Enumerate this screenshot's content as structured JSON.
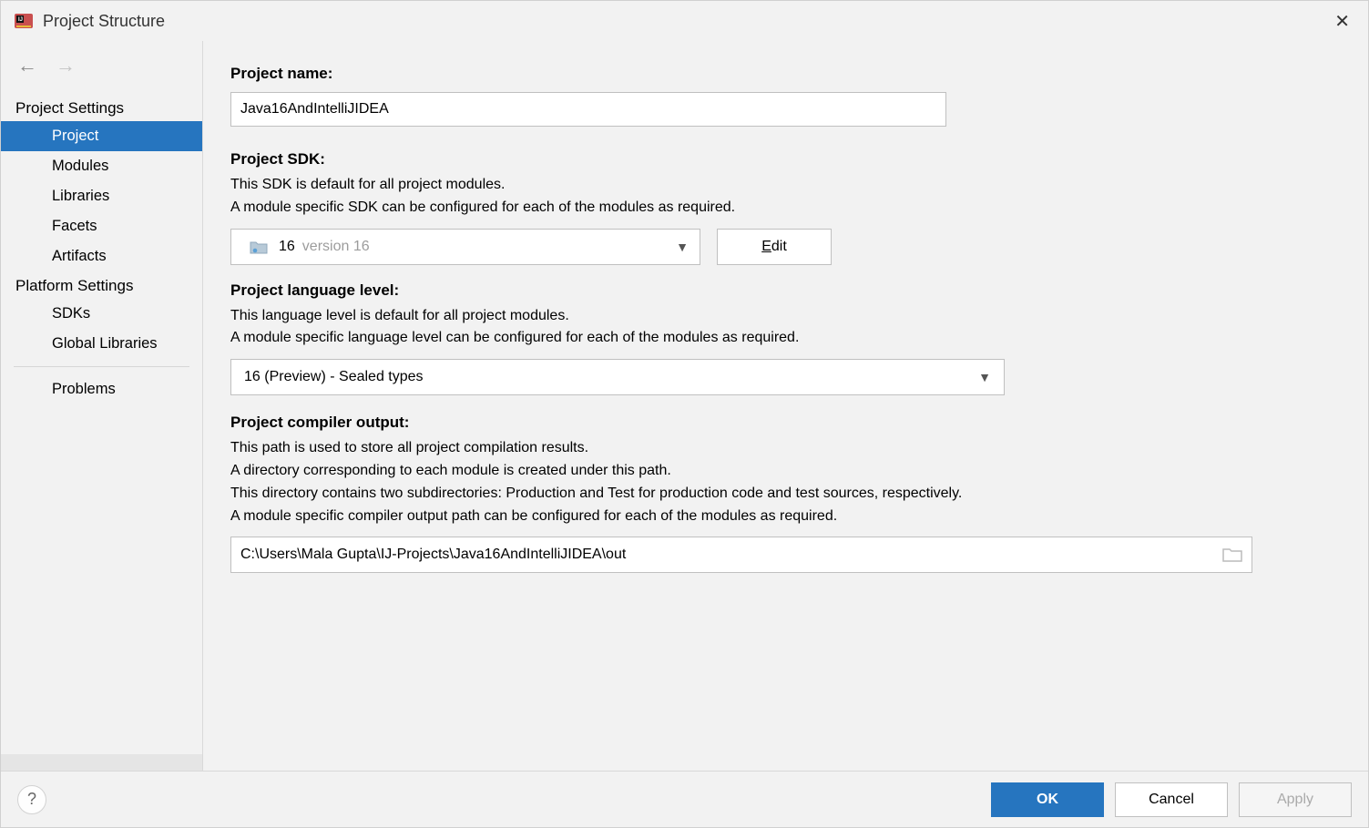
{
  "title": "Project Structure",
  "sidebar": {
    "heading_project_settings": "Project Settings",
    "items_project": [
      "Project",
      "Modules",
      "Libraries",
      "Facets",
      "Artifacts"
    ],
    "heading_platform_settings": "Platform Settings",
    "items_platform": [
      "SDKs",
      "Global Libraries"
    ],
    "item_problems": "Problems",
    "active": "Project"
  },
  "main": {
    "project_name_label": "Project name:",
    "project_name_value": "Java16AndIntelliJIDEA",
    "project_sdk_label": "Project SDK:",
    "project_sdk_desc1": "This SDK is default for all project modules.",
    "project_sdk_desc2": "A module specific SDK can be configured for each of the modules as required.",
    "sdk_selected_main": "16",
    "sdk_selected_version": "version 16",
    "edit_button": "Edit",
    "lang_level_label": "Project language level:",
    "lang_level_desc1": "This language level is default for all project modules.",
    "lang_level_desc2": "A module specific language level can be configured for each of the modules as required.",
    "lang_level_value": "16 (Preview) - Sealed types",
    "compiler_output_label": "Project compiler output:",
    "compiler_output_desc1": "This path is used to store all project compilation results.",
    "compiler_output_desc2": "A directory corresponding to each module is created under this path.",
    "compiler_output_desc3": "This directory contains two subdirectories: Production and Test for production code and test sources, respectively.",
    "compiler_output_desc4": "A module specific compiler output path can be configured for each of the modules as required.",
    "compiler_output_value": "C:\\Users\\Mala Gupta\\IJ-Projects\\Java16AndIntelliJIDEA\\out"
  },
  "footer": {
    "ok": "OK",
    "cancel": "Cancel",
    "apply": "Apply"
  }
}
